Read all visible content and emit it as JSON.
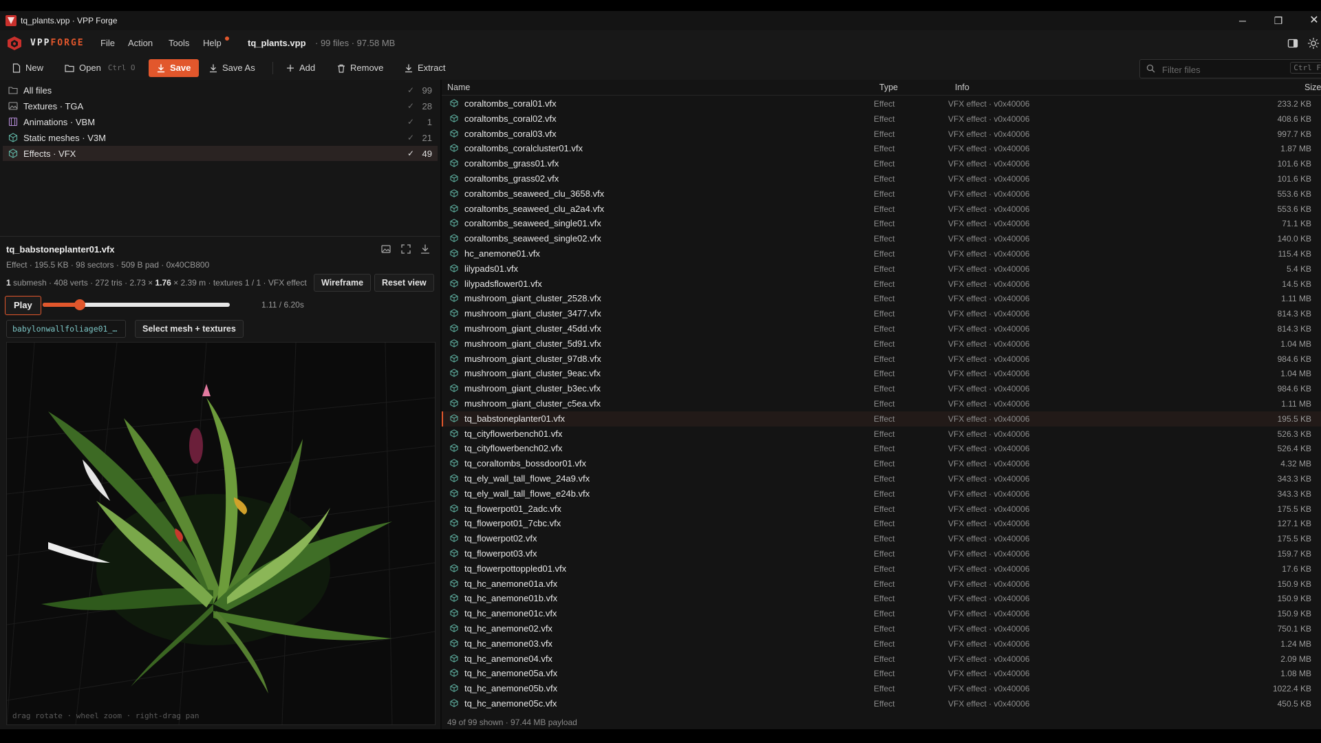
{
  "window": {
    "title": "tq_plants.vpp · VPP Forge",
    "minimize_glyph": "─",
    "restore_glyph": "❐",
    "close_glyph": "✕"
  },
  "menubar": {
    "logo_vpp": "VPP",
    "logo_forge": "FORGE",
    "items": [
      "File",
      "Action",
      "Tools",
      "Help"
    ],
    "archive_name": "tq_plants.vpp",
    "archive_meta": "· 99 files · 97.58 MB"
  },
  "toolbar": {
    "new_label": "New",
    "open_label": "Open",
    "open_shortcut": "Ctrl O",
    "save_label": "Save",
    "save_as_label": "Save As",
    "add_label": "Add",
    "remove_label": "Remove",
    "extract_label": "Extract",
    "filter_placeholder": "Filter files",
    "filter_shortcut": "Ctrl F"
  },
  "categories": [
    {
      "label": "All files",
      "count": "99",
      "icon": "folder-icon"
    },
    {
      "label": "Textures · TGA",
      "count": "28",
      "icon": "image-icon"
    },
    {
      "label": "Animations · VBM",
      "count": "1",
      "icon": "film-icon"
    },
    {
      "label": "Static meshes · V3M",
      "count": "21",
      "icon": "cube-icon"
    },
    {
      "label": "Effects · VFX",
      "count": "49",
      "icon": "effect-icon"
    }
  ],
  "preview": {
    "title": "tq_babstoneplanter01.vfx",
    "meta": "Effect · 195.5 KB · 98 sectors · 509 B pad · 0x40CB800",
    "stats_a": "1",
    "stats_b": " submesh · 408 verts · 272 tris · 2.73 × ",
    "stats_c": "1.76",
    "stats_d": " × 2.39 m · textures 1 / 1 · VFX effect",
    "wireframe_label": "Wireframe",
    "reset_label": "Reset view",
    "play_label": "Play",
    "progress": 0.2,
    "time": "1.11 / 6.20s",
    "mesh_chip": "babylonwallfoliage01_…",
    "select_label": "Select mesh + textures",
    "viewport_hint": "drag rotate · wheel zoom · right-drag pan"
  },
  "list": {
    "columns": {
      "name": "Name",
      "type": "Type",
      "info": "Info",
      "size": "Size"
    },
    "rows": [
      {
        "name": "coraltombs_coral01.vfx",
        "type": "Effect",
        "info": "VFX effect · v0x40006",
        "size": "233.2 KB"
      },
      {
        "name": "coraltombs_coral02.vfx",
        "type": "Effect",
        "info": "VFX effect · v0x40006",
        "size": "408.6 KB"
      },
      {
        "name": "coraltombs_coral03.vfx",
        "type": "Effect",
        "info": "VFX effect · v0x40006",
        "size": "997.7 KB"
      },
      {
        "name": "coraltombs_coralcluster01.vfx",
        "type": "Effect",
        "info": "VFX effect · v0x40006",
        "size": "1.87 MB"
      },
      {
        "name": "coraltombs_grass01.vfx",
        "type": "Effect",
        "info": "VFX effect · v0x40006",
        "size": "101.6 KB"
      },
      {
        "name": "coraltombs_grass02.vfx",
        "type": "Effect",
        "info": "VFX effect · v0x40006",
        "size": "101.6 KB"
      },
      {
        "name": "coraltombs_seaweed_clu_3658.vfx",
        "type": "Effect",
        "info": "VFX effect · v0x40006",
        "size": "553.6 KB"
      },
      {
        "name": "coraltombs_seaweed_clu_a2a4.vfx",
        "type": "Effect",
        "info": "VFX effect · v0x40006",
        "size": "553.6 KB"
      },
      {
        "name": "coraltombs_seaweed_single01.vfx",
        "type": "Effect",
        "info": "VFX effect · v0x40006",
        "size": "71.1 KB"
      },
      {
        "name": "coraltombs_seaweed_single02.vfx",
        "type": "Effect",
        "info": "VFX effect · v0x40006",
        "size": "140.0 KB"
      },
      {
        "name": "hc_anemone01.vfx",
        "type": "Effect",
        "info": "VFX effect · v0x40006",
        "size": "115.4 KB"
      },
      {
        "name": "lilypads01.vfx",
        "type": "Effect",
        "info": "VFX effect · v0x40006",
        "size": "5.4 KB"
      },
      {
        "name": "lilypadsflower01.vfx",
        "type": "Effect",
        "info": "VFX effect · v0x40006",
        "size": "14.5 KB"
      },
      {
        "name": "mushroom_giant_cluster_2528.vfx",
        "type": "Effect",
        "info": "VFX effect · v0x40006",
        "size": "1.11 MB"
      },
      {
        "name": "mushroom_giant_cluster_3477.vfx",
        "type": "Effect",
        "info": "VFX effect · v0x40006",
        "size": "814.3 KB"
      },
      {
        "name": "mushroom_giant_cluster_45dd.vfx",
        "type": "Effect",
        "info": "VFX effect · v0x40006",
        "size": "814.3 KB"
      },
      {
        "name": "mushroom_giant_cluster_5d91.vfx",
        "type": "Effect",
        "info": "VFX effect · v0x40006",
        "size": "1.04 MB"
      },
      {
        "name": "mushroom_giant_cluster_97d8.vfx",
        "type": "Effect",
        "info": "VFX effect · v0x40006",
        "size": "984.6 KB"
      },
      {
        "name": "mushroom_giant_cluster_9eac.vfx",
        "type": "Effect",
        "info": "VFX effect · v0x40006",
        "size": "1.04 MB"
      },
      {
        "name": "mushroom_giant_cluster_b3ec.vfx",
        "type": "Effect",
        "info": "VFX effect · v0x40006",
        "size": "984.6 KB"
      },
      {
        "name": "mushroom_giant_cluster_c5ea.vfx",
        "type": "Effect",
        "info": "VFX effect · v0x40006",
        "size": "1.11 MB"
      },
      {
        "name": "tq_babstoneplanter01.vfx",
        "type": "Effect",
        "info": "VFX effect · v0x40006",
        "size": "195.5 KB"
      },
      {
        "name": "tq_cityflowerbench01.vfx",
        "type": "Effect",
        "info": "VFX effect · v0x40006",
        "size": "526.3 KB"
      },
      {
        "name": "tq_cityflowerbench02.vfx",
        "type": "Effect",
        "info": "VFX effect · v0x40006",
        "size": "526.4 KB"
      },
      {
        "name": "tq_coraltombs_bossdoor01.vfx",
        "type": "Effect",
        "info": "VFX effect · v0x40006",
        "size": "4.32 MB"
      },
      {
        "name": "tq_ely_wall_tall_flowe_24a9.vfx",
        "type": "Effect",
        "info": "VFX effect · v0x40006",
        "size": "343.3 KB"
      },
      {
        "name": "tq_ely_wall_tall_flowe_e24b.vfx",
        "type": "Effect",
        "info": "VFX effect · v0x40006",
        "size": "343.3 KB"
      },
      {
        "name": "tq_flowerpot01_2adc.vfx",
        "type": "Effect",
        "info": "VFX effect · v0x40006",
        "size": "175.5 KB"
      },
      {
        "name": "tq_flowerpot01_7cbc.vfx",
        "type": "Effect",
        "info": "VFX effect · v0x40006",
        "size": "127.1 KB"
      },
      {
        "name": "tq_flowerpot02.vfx",
        "type": "Effect",
        "info": "VFX effect · v0x40006",
        "size": "175.5 KB"
      },
      {
        "name": "tq_flowerpot03.vfx",
        "type": "Effect",
        "info": "VFX effect · v0x40006",
        "size": "159.7 KB"
      },
      {
        "name": "tq_flowerpottoppled01.vfx",
        "type": "Effect",
        "info": "VFX effect · v0x40006",
        "size": "17.6 KB"
      },
      {
        "name": "tq_hc_anemone01a.vfx",
        "type": "Effect",
        "info": "VFX effect · v0x40006",
        "size": "150.9 KB"
      },
      {
        "name": "tq_hc_anemone01b.vfx",
        "type": "Effect",
        "info": "VFX effect · v0x40006",
        "size": "150.9 KB"
      },
      {
        "name": "tq_hc_anemone01c.vfx",
        "type": "Effect",
        "info": "VFX effect · v0x40006",
        "size": "150.9 KB"
      },
      {
        "name": "tq_hc_anemone02.vfx",
        "type": "Effect",
        "info": "VFX effect · v0x40006",
        "size": "750.1 KB"
      },
      {
        "name": "tq_hc_anemone03.vfx",
        "type": "Effect",
        "info": "VFX effect · v0x40006",
        "size": "1.24 MB"
      },
      {
        "name": "tq_hc_anemone04.vfx",
        "type": "Effect",
        "info": "VFX effect · v0x40006",
        "size": "2.09 MB"
      },
      {
        "name": "tq_hc_anemone05a.vfx",
        "type": "Effect",
        "info": "VFX effect · v0x40006",
        "size": "1.08 MB"
      },
      {
        "name": "tq_hc_anemone05b.vfx",
        "type": "Effect",
        "info": "VFX effect · v0x40006",
        "size": "1022.4 KB"
      },
      {
        "name": "tq_hc_anemone05c.vfx",
        "type": "Effect",
        "info": "VFX effect · v0x40006",
        "size": "450.5 KB"
      }
    ],
    "selected_index": 21
  },
  "status": "49 of 99 shown · 97.44 MB payload",
  "colors": {
    "accent": "#e2572c",
    "background": "#141414",
    "chip_text": "#7cc6c6"
  }
}
